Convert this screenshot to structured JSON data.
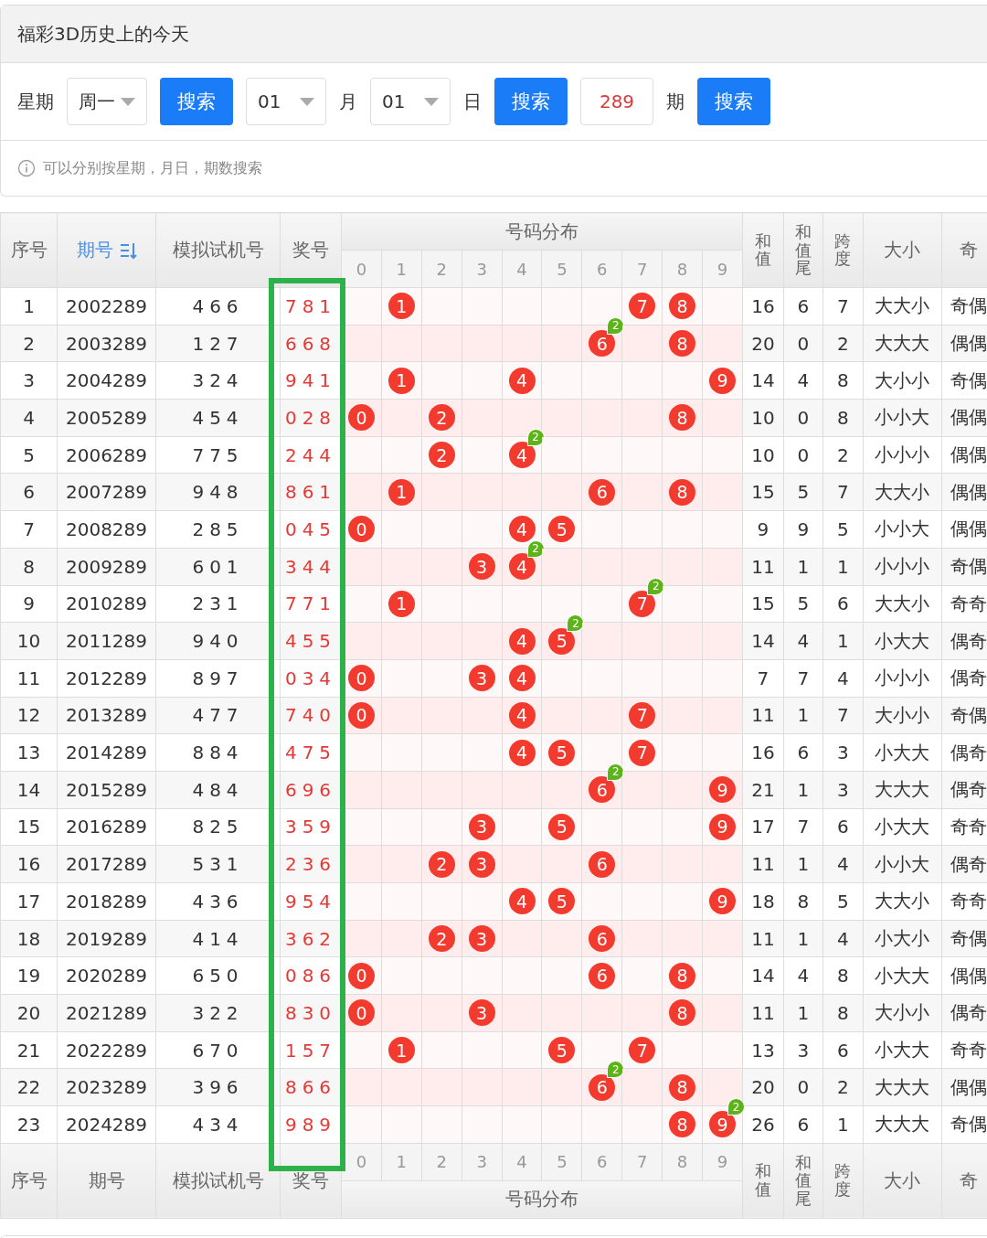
{
  "panel": {
    "title": "福彩3D历史上的今天",
    "weekday_label": "星期",
    "weekday": "周一",
    "month": "01",
    "month_label": "月",
    "day": "01",
    "day_label": "日",
    "issue": "289",
    "issue_label": "期",
    "search_buttons": [
      "搜索",
      "搜索",
      "搜索"
    ],
    "hint": "可以分别按星期，月日，期数搜索"
  },
  "table": {
    "header": {
      "no": "序号",
      "period": "期号",
      "sim": "模拟试机号",
      "prize": "奖号",
      "dist": "号码分布",
      "digits": [
        "0",
        "1",
        "2",
        "3",
        "4",
        "5",
        "6",
        "7",
        "8",
        "9"
      ],
      "sum": "和值",
      "tail": "和值尾",
      "span": "跨度",
      "size": "大小",
      "parity": "奇"
    },
    "footer": {
      "no": "序号",
      "period": "期号",
      "sim": "模拟试机号",
      "prize": "奖号",
      "dist": "号码分布",
      "digits": [
        "0",
        "1",
        "2",
        "3",
        "4",
        "5",
        "6",
        "7",
        "8",
        "9"
      ],
      "sum": "和值",
      "tail": "和值尾",
      "span": "跨度",
      "size": "大小",
      "parity": "奇"
    },
    "rows": [
      {
        "no": "1",
        "period": "2002289",
        "sim": "466",
        "prize": "781",
        "sum": "16",
        "tail": "6",
        "span": "7",
        "size": "大大小",
        "parity": "奇偶",
        "cells": [
          {},
          {
            "ball": "1"
          },
          {},
          {},
          {},
          {},
          {},
          {
            "ball": "7"
          },
          {
            "ball": "8"
          },
          {}
        ]
      },
      {
        "no": "2",
        "period": "2003289",
        "sim": "127",
        "prize": "668",
        "sum": "20",
        "tail": "0",
        "span": "2",
        "size": "大大大",
        "parity": "偶偶",
        "cells": [
          {},
          {},
          {},
          {},
          {},
          {},
          {
            "ball": "6",
            "badge": "2"
          },
          {},
          {
            "ball": "8"
          },
          {}
        ]
      },
      {
        "no": "3",
        "period": "2004289",
        "sim": "324",
        "prize": "941",
        "sum": "14",
        "tail": "4",
        "span": "8",
        "size": "大小小",
        "parity": "奇偶",
        "cells": [
          {},
          {
            "ball": "1"
          },
          {},
          {},
          {
            "ball": "4"
          },
          {},
          {},
          {},
          {},
          {
            "ball": "9"
          }
        ]
      },
      {
        "no": "4",
        "period": "2005289",
        "sim": "454",
        "prize": "028",
        "sum": "10",
        "tail": "0",
        "span": "8",
        "size": "小小大",
        "parity": "偶偶",
        "cells": [
          {
            "ball": "0"
          },
          {},
          {
            "ball": "2"
          },
          {},
          {},
          {},
          {},
          {},
          {
            "ball": "8"
          },
          {}
        ]
      },
      {
        "no": "5",
        "period": "2006289",
        "sim": "775",
        "prize": "244",
        "sum": "10",
        "tail": "0",
        "span": "2",
        "size": "小小小",
        "parity": "偶偶",
        "cells": [
          {},
          {},
          {
            "ball": "2"
          },
          {},
          {
            "ball": "4",
            "badge": "2"
          },
          {},
          {},
          {},
          {},
          {}
        ]
      },
      {
        "no": "6",
        "period": "2007289",
        "sim": "948",
        "prize": "861",
        "sum": "15",
        "tail": "5",
        "span": "7",
        "size": "大大小",
        "parity": "偶偶",
        "cells": [
          {},
          {
            "ball": "1"
          },
          {},
          {},
          {},
          {},
          {
            "ball": "6"
          },
          {},
          {
            "ball": "8"
          },
          {}
        ]
      },
      {
        "no": "7",
        "period": "2008289",
        "sim": "285",
        "prize": "045",
        "sum": "9",
        "tail": "9",
        "span": "5",
        "size": "小小大",
        "parity": "偶偶",
        "cells": [
          {
            "ball": "0"
          },
          {},
          {},
          {},
          {
            "ball": "4"
          },
          {
            "ball": "5"
          },
          {},
          {},
          {},
          {}
        ]
      },
      {
        "no": "8",
        "period": "2009289",
        "sim": "601",
        "prize": "344",
        "sum": "11",
        "tail": "1",
        "span": "1",
        "size": "小小小",
        "parity": "奇偶",
        "cells": [
          {},
          {},
          {},
          {
            "ball": "3"
          },
          {
            "ball": "4",
            "badge": "2"
          },
          {},
          {},
          {},
          {},
          {}
        ]
      },
      {
        "no": "9",
        "period": "2010289",
        "sim": "231",
        "prize": "771",
        "sum": "15",
        "tail": "5",
        "span": "6",
        "size": "大大小",
        "parity": "奇奇",
        "cells": [
          {},
          {
            "ball": "1"
          },
          {},
          {},
          {},
          {},
          {},
          {
            "ball": "7",
            "badge": "2"
          },
          {},
          {}
        ]
      },
      {
        "no": "10",
        "period": "2011289",
        "sim": "940",
        "prize": "455",
        "sum": "14",
        "tail": "4",
        "span": "1",
        "size": "小大大",
        "parity": "偶奇",
        "cells": [
          {},
          {},
          {},
          {},
          {
            "ball": "4"
          },
          {
            "ball": "5",
            "badge": "2"
          },
          {},
          {},
          {},
          {}
        ]
      },
      {
        "no": "11",
        "period": "2012289",
        "sim": "897",
        "prize": "034",
        "sum": "7",
        "tail": "7",
        "span": "4",
        "size": "小小小",
        "parity": "偶奇",
        "cells": [
          {
            "ball": "0"
          },
          {},
          {},
          {
            "ball": "3"
          },
          {
            "ball": "4"
          },
          {},
          {},
          {},
          {},
          {}
        ]
      },
      {
        "no": "12",
        "period": "2013289",
        "sim": "477",
        "prize": "740",
        "sum": "11",
        "tail": "1",
        "span": "7",
        "size": "大小小",
        "parity": "奇偶",
        "cells": [
          {
            "ball": "0"
          },
          {},
          {},
          {},
          {
            "ball": "4"
          },
          {},
          {},
          {
            "ball": "7"
          },
          {},
          {}
        ]
      },
      {
        "no": "13",
        "period": "2014289",
        "sim": "884",
        "prize": "475",
        "sum": "16",
        "tail": "6",
        "span": "3",
        "size": "小大大",
        "parity": "偶奇",
        "cells": [
          {},
          {},
          {},
          {},
          {
            "ball": "4"
          },
          {
            "ball": "5"
          },
          {},
          {
            "ball": "7"
          },
          {},
          {}
        ]
      },
      {
        "no": "14",
        "period": "2015289",
        "sim": "484",
        "prize": "696",
        "sum": "21",
        "tail": "1",
        "span": "3",
        "size": "大大大",
        "parity": "偶奇",
        "cells": [
          {},
          {},
          {},
          {},
          {},
          {},
          {
            "ball": "6",
            "badge": "2"
          },
          {},
          {},
          {
            "ball": "9"
          }
        ]
      },
      {
        "no": "15",
        "period": "2016289",
        "sim": "825",
        "prize": "359",
        "sum": "17",
        "tail": "7",
        "span": "6",
        "size": "小大大",
        "parity": "奇奇",
        "cells": [
          {},
          {},
          {},
          {
            "ball": "3"
          },
          {},
          {
            "ball": "5"
          },
          {},
          {},
          {},
          {
            "ball": "9"
          }
        ]
      },
      {
        "no": "16",
        "period": "2017289",
        "sim": "531",
        "prize": "236",
        "sum": "11",
        "tail": "1",
        "span": "4",
        "size": "小小大",
        "parity": "偶奇",
        "cells": [
          {},
          {},
          {
            "ball": "2"
          },
          {
            "ball": "3"
          },
          {},
          {},
          {
            "ball": "6"
          },
          {},
          {},
          {}
        ]
      },
      {
        "no": "17",
        "period": "2018289",
        "sim": "436",
        "prize": "954",
        "sum": "18",
        "tail": "8",
        "span": "5",
        "size": "大大小",
        "parity": "奇奇",
        "cells": [
          {},
          {},
          {},
          {},
          {
            "ball": "4"
          },
          {
            "ball": "5"
          },
          {},
          {},
          {},
          {
            "ball": "9"
          }
        ]
      },
      {
        "no": "18",
        "period": "2019289",
        "sim": "414",
        "prize": "362",
        "sum": "11",
        "tail": "1",
        "span": "4",
        "size": "小大小",
        "parity": "奇偶",
        "cells": [
          {},
          {},
          {
            "ball": "2"
          },
          {
            "ball": "3"
          },
          {},
          {},
          {
            "ball": "6"
          },
          {},
          {},
          {}
        ]
      },
      {
        "no": "19",
        "period": "2020289",
        "sim": "650",
        "prize": "086",
        "sum": "14",
        "tail": "4",
        "span": "8",
        "size": "小大大",
        "parity": "偶偶",
        "cells": [
          {
            "ball": "0"
          },
          {},
          {},
          {},
          {},
          {},
          {
            "ball": "6"
          },
          {},
          {
            "ball": "8"
          },
          {}
        ]
      },
      {
        "no": "20",
        "period": "2021289",
        "sim": "322",
        "prize": "830",
        "sum": "11",
        "tail": "1",
        "span": "8",
        "size": "大小小",
        "parity": "偶奇",
        "cells": [
          {
            "ball": "0"
          },
          {},
          {},
          {
            "ball": "3"
          },
          {},
          {},
          {},
          {},
          {
            "ball": "8"
          },
          {}
        ]
      },
      {
        "no": "21",
        "period": "2022289",
        "sim": "670",
        "prize": "157",
        "sum": "13",
        "tail": "3",
        "span": "6",
        "size": "小大大",
        "parity": "奇奇",
        "cells": [
          {},
          {
            "ball": "1"
          },
          {},
          {},
          {},
          {
            "ball": "5"
          },
          {},
          {
            "ball": "7"
          },
          {},
          {}
        ]
      },
      {
        "no": "22",
        "period": "2023289",
        "sim": "396",
        "prize": "866",
        "sum": "20",
        "tail": "0",
        "span": "2",
        "size": "大大大",
        "parity": "偶偶",
        "cells": [
          {},
          {},
          {},
          {},
          {},
          {},
          {
            "ball": "6",
            "badge": "2"
          },
          {},
          {
            "ball": "8"
          },
          {}
        ]
      },
      {
        "no": "23",
        "period": "2024289",
        "sim": "434",
        "prize": "989",
        "sum": "26",
        "tail": "6",
        "span": "1",
        "size": "大大大",
        "parity": "奇偶",
        "cells": [
          {},
          {},
          {},
          {},
          {},
          {},
          {},
          {},
          {
            "ball": "8"
          },
          {
            "ball": "9",
            "badge": "2"
          }
        ]
      }
    ]
  }
}
